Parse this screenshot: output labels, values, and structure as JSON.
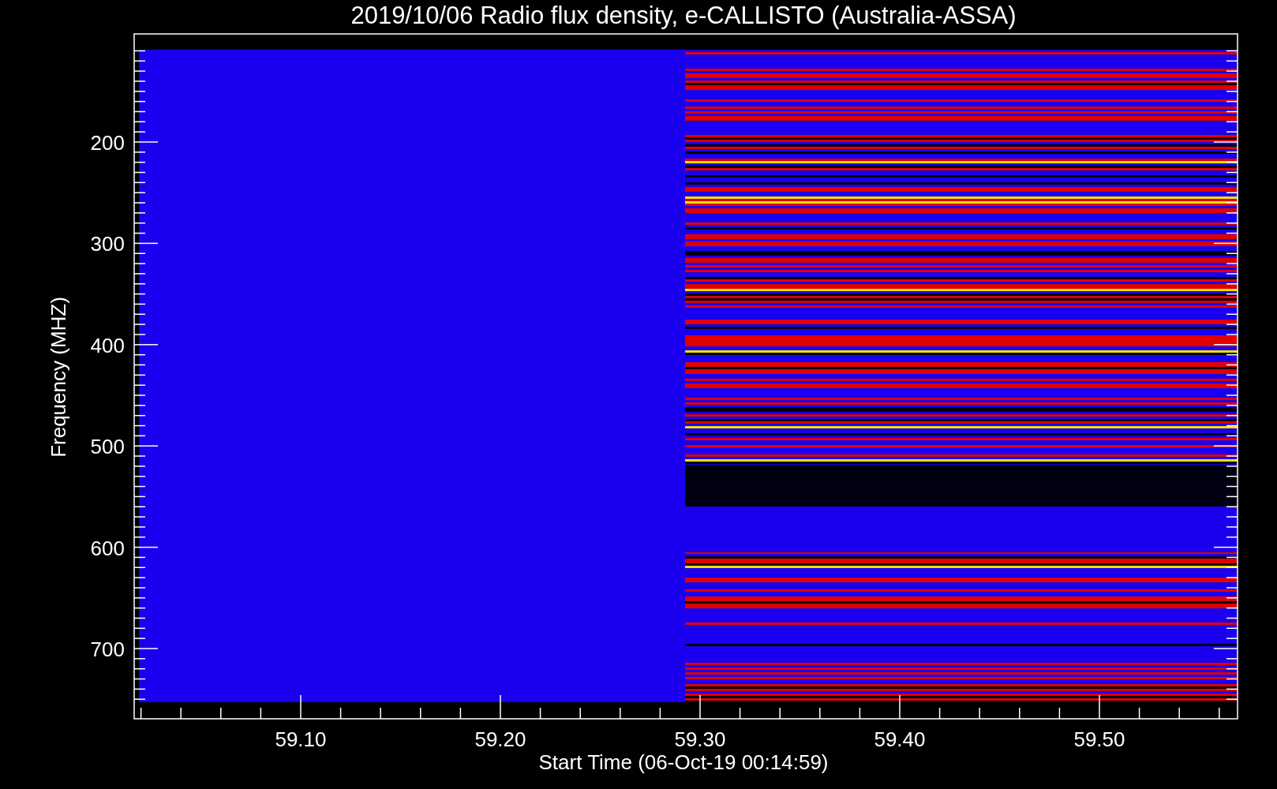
{
  "plot": {
    "title": "2019/10/06  Radio flux density, e-CALLISTO (Australia-ASSA)",
    "xlabel": "Start Time (06-Oct-19 00:14:59)",
    "ylabel": "Frequency (MHZ)",
    "xticks": [
      "59.10",
      "59.20",
      "59.30",
      "59.40",
      "59.50"
    ],
    "yticks": [
      "200",
      "300",
      "400",
      "500",
      "600",
      "700"
    ]
  }
}
